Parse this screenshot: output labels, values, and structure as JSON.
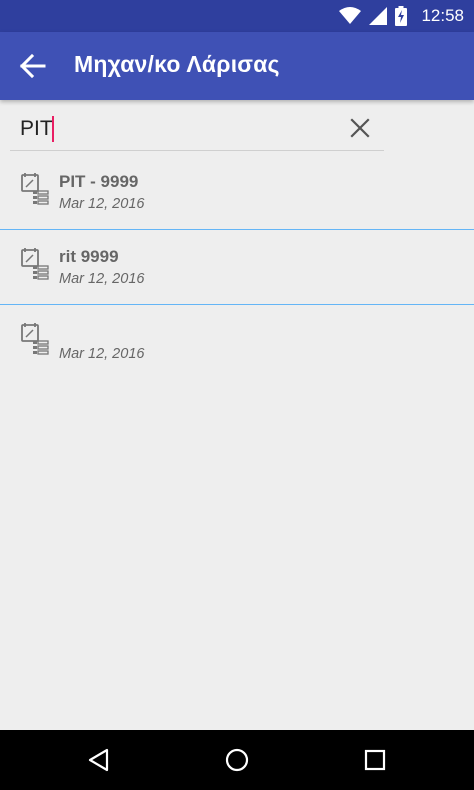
{
  "status_bar": {
    "time": "12:58"
  },
  "app_bar": {
    "title": "Μηχαν/κο Λάρισας"
  },
  "search": {
    "value": "PIT"
  },
  "results": [
    {
      "title": "PIT - 9999",
      "date": "Mar 12, 2016"
    },
    {
      "title": "rit 9999",
      "date": "Mar 12, 2016"
    },
    {
      "title": "",
      "date": "Mar 12, 2016"
    }
  ],
  "colors": {
    "status_bar": "#2f3f9e",
    "app_bar": "#3f51b5",
    "caret": "#e91e63",
    "divider": "#64b5f6",
    "background": "#eeeeee"
  },
  "icons": {
    "back": "arrow-back-icon",
    "clear": "close-icon",
    "item": "note-list-icon",
    "nav_back": "triangle-back-icon",
    "nav_home": "circle-home-icon",
    "nav_recents": "square-recents-icon"
  }
}
